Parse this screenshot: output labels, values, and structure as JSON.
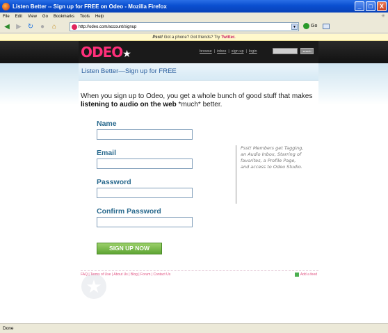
{
  "window": {
    "title": "Listen Better -- Sign up for FREE on Odeo - Mozilla Firefox",
    "min_label": "_",
    "max_label": "□",
    "close_label": "X"
  },
  "menu": {
    "items": [
      "File",
      "Edit",
      "View",
      "Go",
      "Bookmarks",
      "Tools",
      "Help"
    ]
  },
  "toolbar": {
    "url": "http://odeo.com/account/signup",
    "go_label": "Go"
  },
  "notice": {
    "psst": "Psst!",
    "text": " Got a phone? Got friends? Try ",
    "link": "Twitter."
  },
  "header": {
    "logo": "ODEO",
    "nav": [
      "browse",
      "inbox",
      "sign up",
      "login"
    ],
    "search_button": "search"
  },
  "page": {
    "subhead": "Listen Better—Sign up for FREE",
    "intro_pre": "When you sign up to Odeo, you get a whole bunch of good stuff that makes ",
    "intro_bold": "listening to audio on the web",
    "intro_post": " *much* better.",
    "side_note": "Psst! Members get Tagging, an Audio Inbox, Starring of favorites, a Profile Page, and access to Odeo Studio."
  },
  "form": {
    "name_label": "Name",
    "email_label": "Email",
    "password_label": "Password",
    "confirm_label": "Confirm Password",
    "name_value": "",
    "email_value": "",
    "password_value": "",
    "confirm_value": "",
    "submit_label": "SIGN UP NOW"
  },
  "footer": {
    "links": "FAQ | Terms of Use | About Us | Blog | Forum | Contact Us",
    "add_feed": "Add a feed"
  },
  "status": {
    "text": "Done"
  }
}
